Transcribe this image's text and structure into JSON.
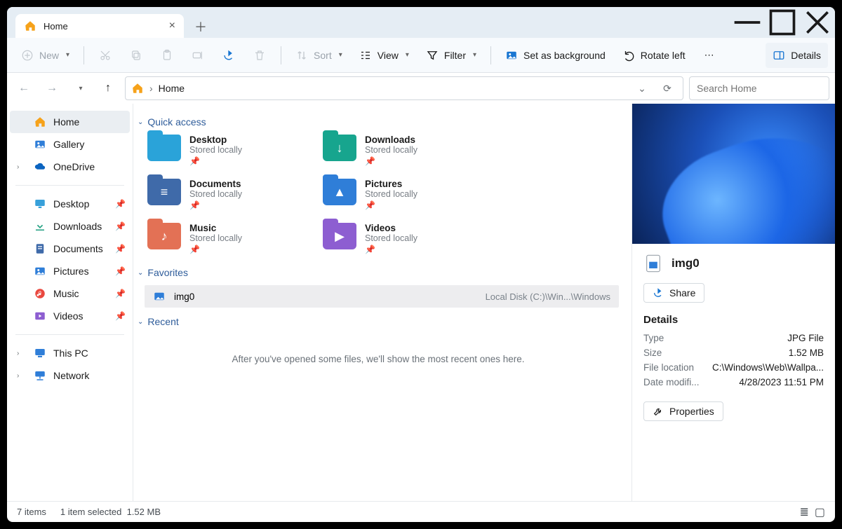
{
  "tab": {
    "title": "Home"
  },
  "toolbar": {
    "new": "New",
    "sort": "Sort",
    "view": "View",
    "filter": "Filter",
    "set_bg": "Set as background",
    "rotate_left": "Rotate left",
    "details": "Details"
  },
  "address": {
    "location": "Home"
  },
  "search": {
    "placeholder": "Search Home"
  },
  "sidebar": {
    "top": [
      {
        "label": "Home",
        "icon": "home",
        "selected": true
      },
      {
        "label": "Gallery",
        "icon": "gallery"
      },
      {
        "label": "OneDrive",
        "icon": "onedrive",
        "expandable": true
      }
    ],
    "pinned": [
      {
        "label": "Desktop",
        "icon": "desktop"
      },
      {
        "label": "Downloads",
        "icon": "downloads"
      },
      {
        "label": "Documents",
        "icon": "documents"
      },
      {
        "label": "Pictures",
        "icon": "pictures"
      },
      {
        "label": "Music",
        "icon": "music"
      },
      {
        "label": "Videos",
        "icon": "videos"
      }
    ],
    "bottom": [
      {
        "label": "This PC",
        "icon": "thispc",
        "expandable": true
      },
      {
        "label": "Network",
        "icon": "network",
        "expandable": true
      }
    ]
  },
  "sections": {
    "quick_access": "Quick access",
    "favorites": "Favorites",
    "recent": "Recent"
  },
  "quick_access": [
    {
      "name": "Desktop",
      "sub": "Stored locally",
      "color": "#2aa3d9"
    },
    {
      "name": "Downloads",
      "sub": "Stored locally",
      "color": "#17a58e"
    },
    {
      "name": "Documents",
      "sub": "Stored locally",
      "color": "#3f6aa9"
    },
    {
      "name": "Pictures",
      "sub": "Stored locally",
      "color": "#2f7ed8"
    },
    {
      "name": "Music",
      "sub": "Stored locally",
      "color": "#e37155"
    },
    {
      "name": "Videos",
      "sub": "Stored locally",
      "color": "#8d5ed1"
    }
  ],
  "favorites": [
    {
      "name": "img0",
      "path": "Local Disk (C:)\\Win...\\Windows"
    }
  ],
  "recent_empty": "After you've opened some files, we'll show the most recent ones here.",
  "preview": {
    "filename": "img0",
    "share": "Share",
    "details_header": "Details",
    "rows": [
      {
        "k": "Type",
        "v": "JPG File"
      },
      {
        "k": "Size",
        "v": "1.52 MB"
      },
      {
        "k": "File location",
        "v": "C:\\Windows\\Web\\Wallpa..."
      },
      {
        "k": "Date modifi...",
        "v": "4/28/2023 11:51 PM"
      }
    ],
    "properties": "Properties"
  },
  "status": {
    "count": "7 items",
    "selection": "1 item selected",
    "size": "1.52 MB"
  }
}
